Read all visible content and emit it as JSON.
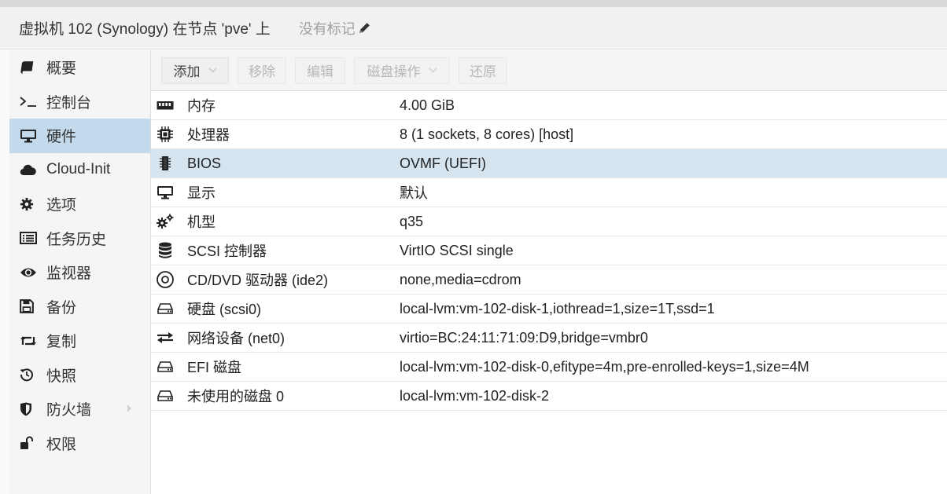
{
  "header": {
    "title": "虚拟机 102 (Synology) 在节点 'pve' 上",
    "tags_label": "没有标记"
  },
  "nav": {
    "items": [
      {
        "label": "概要",
        "icon": "book-icon"
      },
      {
        "label": "控制台",
        "icon": "terminal-icon"
      },
      {
        "label": "硬件",
        "icon": "desktop-icon",
        "active": true
      },
      {
        "label": "Cloud-Init",
        "icon": "cloud-icon"
      },
      {
        "label": "选项",
        "icon": "gear-icon"
      },
      {
        "label": "任务历史",
        "icon": "list-icon"
      },
      {
        "label": "监视器",
        "icon": "eye-icon"
      },
      {
        "label": "备份",
        "icon": "floppy-icon"
      },
      {
        "label": "复制",
        "icon": "retweet-icon"
      },
      {
        "label": "快照",
        "icon": "history-icon"
      },
      {
        "label": "防火墙",
        "icon": "shield-icon",
        "has_arrow": true
      },
      {
        "label": "权限",
        "icon": "unlock-icon"
      }
    ]
  },
  "toolbar": {
    "add": "添加",
    "remove": "移除",
    "edit": "编辑",
    "disk_action": "磁盘操作",
    "revert": "还原"
  },
  "hardware": {
    "rows": [
      {
        "name": "内存",
        "value": "4.00 GiB",
        "icon": "memory-icon"
      },
      {
        "name": "处理器",
        "value": "8 (1 sockets, 8 cores) [host]",
        "icon": "cpu-icon"
      },
      {
        "name": "BIOS",
        "value": "OVMF (UEFI)",
        "icon": "microchip-icon",
        "selected": true
      },
      {
        "name": "显示",
        "value": "默认",
        "icon": "desktop-icon"
      },
      {
        "name": "机型",
        "value": "q35",
        "icon": "cogs-icon"
      },
      {
        "name": "SCSI 控制器",
        "value": "VirtIO SCSI single",
        "icon": "database-icon"
      },
      {
        "name": "CD/DVD 驱动器 (ide2)",
        "value": "none,media=cdrom",
        "icon": "cdrom-icon"
      },
      {
        "name": "硬盘 (scsi0)",
        "value": "local-lvm:vm-102-disk-1,iothread=1,size=1T,ssd=1",
        "icon": "hdd-icon"
      },
      {
        "name": "网络设备 (net0)",
        "value": "virtio=BC:24:11:71:09:D9,bridge=vmbr0",
        "icon": "exchange-icon"
      },
      {
        "name": "EFI 磁盘",
        "value": "local-lvm:vm-102-disk-0,efitype=4m,pre-enrolled-keys=1,size=4M",
        "icon": "hdd-icon"
      },
      {
        "name": "未使用的磁盘 0",
        "value": "local-lvm:vm-102-disk-2",
        "icon": "hdd-icon"
      }
    ]
  }
}
